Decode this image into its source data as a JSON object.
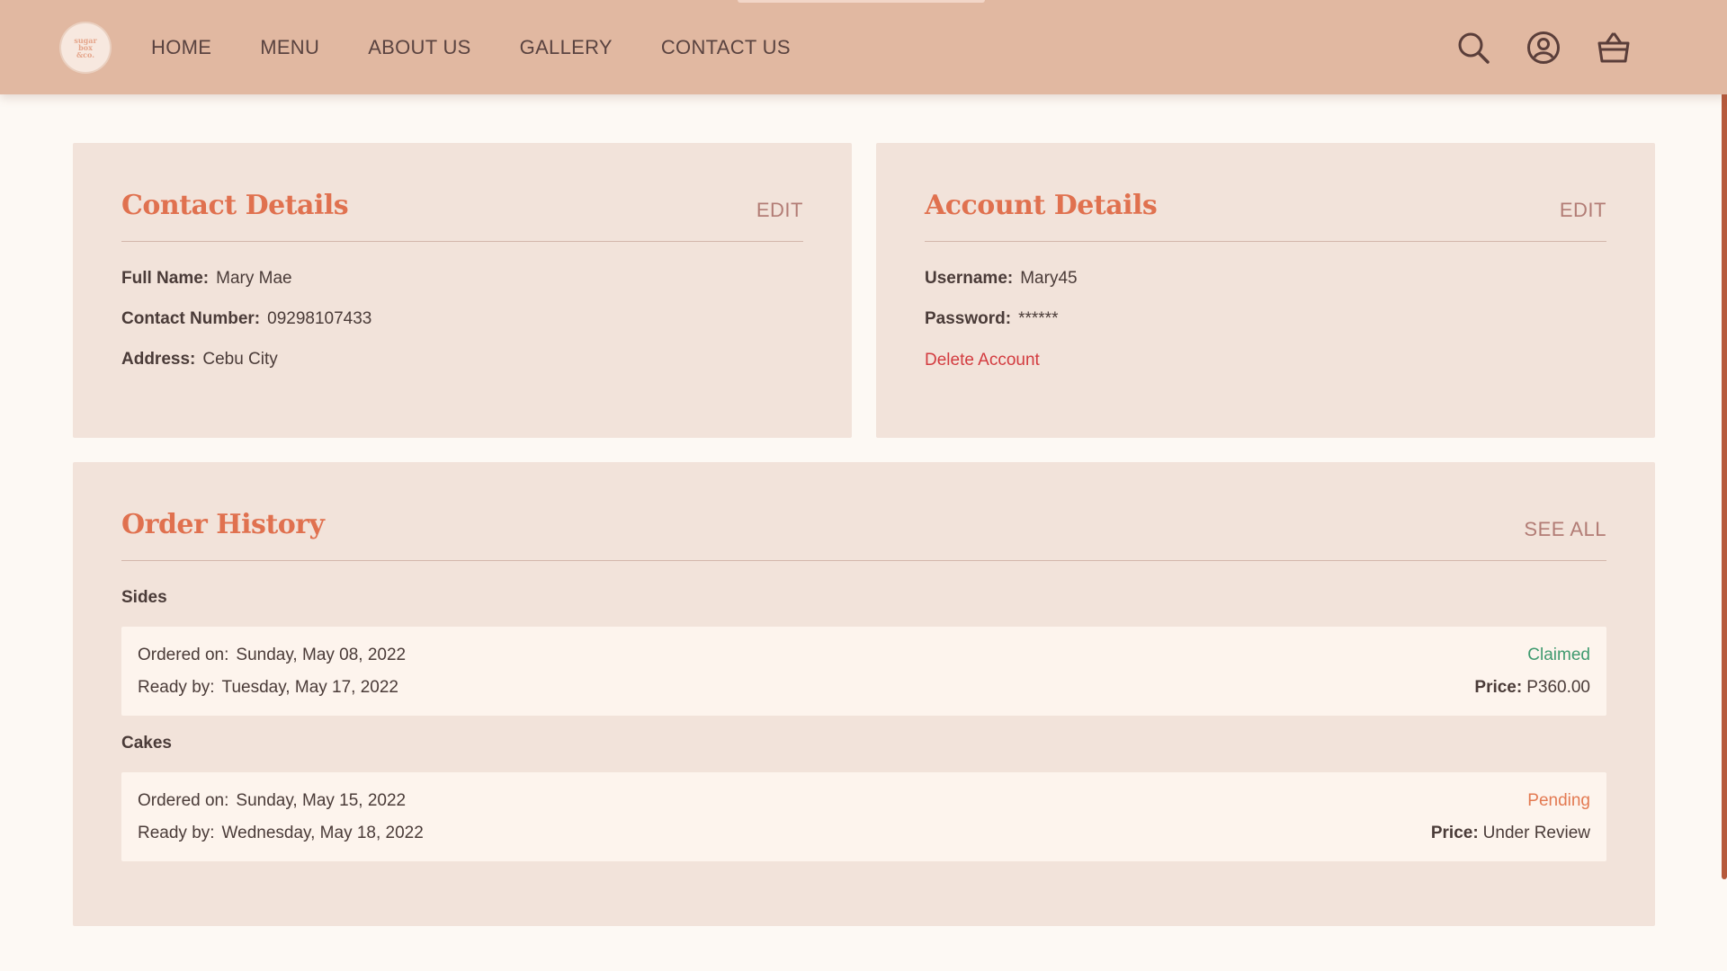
{
  "header": {
    "logo_lines": [
      "sugar",
      "box",
      "&co."
    ],
    "nav": [
      "HOME",
      "MENU",
      "ABOUT US",
      "GALLERY",
      "CONTACT US"
    ],
    "icons": [
      "search-icon",
      "user-icon",
      "basket-icon"
    ]
  },
  "contact": {
    "title": "Contact Details",
    "action": "EDIT",
    "fields": [
      {
        "label": "Full Name:",
        "value": "Mary Mae"
      },
      {
        "label": "Contact Number:",
        "value": "09298107433"
      },
      {
        "label": "Address:",
        "value": "Cebu City"
      }
    ]
  },
  "account": {
    "title": "Account Details",
    "action": "EDIT",
    "fields": [
      {
        "label": "Username:",
        "value": "Mary45"
      },
      {
        "label": "Password:",
        "value": "******"
      }
    ],
    "delete_label": "Delete Account"
  },
  "orders": {
    "title": "Order History",
    "action": "SEE ALL",
    "items": [
      {
        "category": "Sides",
        "ordered_label": "Ordered on:",
        "ordered_on": "Sunday, May 08, 2022",
        "ready_label": "Ready by:",
        "ready_by": "Tuesday, May 17, 2022",
        "status": "Claimed",
        "price_label": "Price:",
        "price": "P360.00"
      },
      {
        "category": "Cakes",
        "ordered_label": "Ordered on:",
        "ordered_on": "Sunday, May 15, 2022",
        "ready_label": "Ready by:",
        "ready_by": "Wednesday, May 18, 2022",
        "status": "Pending",
        "price_label": "Price:",
        "price": "Under Review"
      }
    ]
  },
  "colors": {
    "header_bg": "#e1b8a1",
    "page_bg": "#fdf9f4",
    "card_bg": "#f2e3da",
    "title_accent": "#e0714f",
    "claimed": "#3f9a6f",
    "pending": "#e37a52",
    "delete": "#d33b3f"
  }
}
